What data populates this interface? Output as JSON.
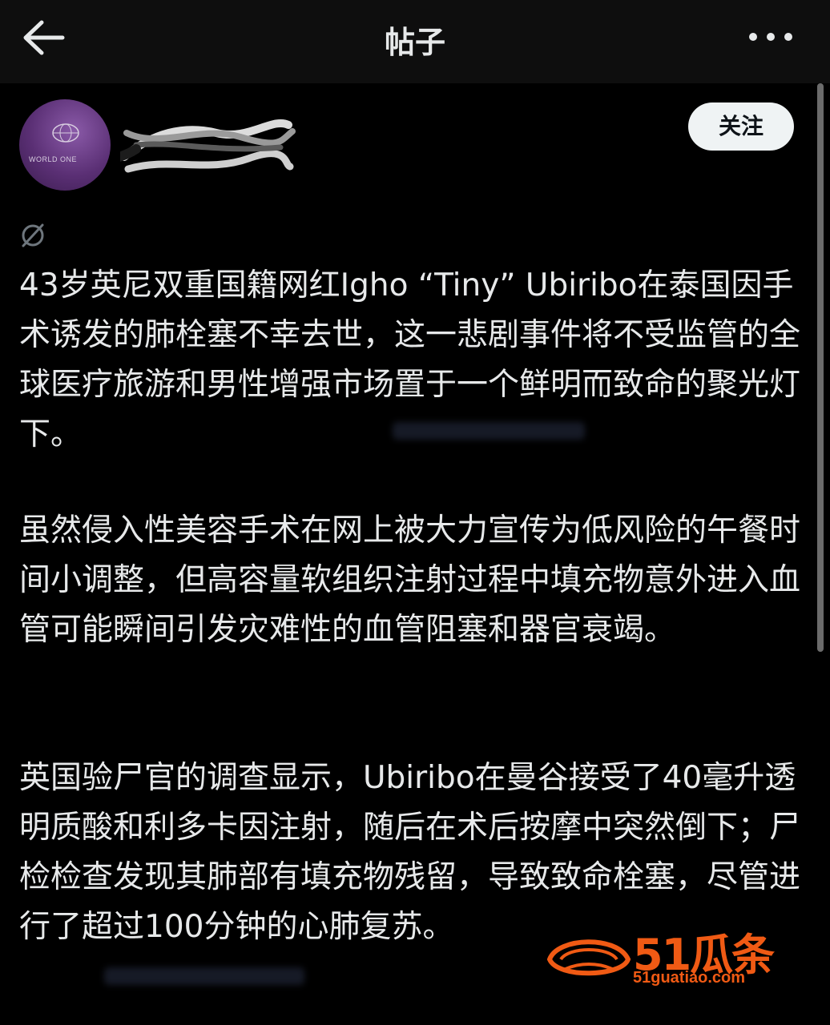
{
  "header": {
    "title": "帖子",
    "back_icon": "arrow-left-icon",
    "more_icon": "more-horizontal-icon"
  },
  "author": {
    "avatar_text": "WORLD ONE",
    "follow_label": "关注"
  },
  "post": {
    "translate_icon": "translate-icon",
    "paragraphs": [
      "43岁英尼双重国籍网红Igho “Tiny” Ubiribo在泰国因手术诱发的肺栓塞不幸去世，这一悲剧事件将不受监管的全球医疗旅游和男性增强市场置于一个鲜明而致命的聚光灯下。",
      "虽然侵入性美容手术在网上被大力宣传为低风险的午餐时间小调整，但高容量软组织注射过程中填充物意外进入血管可能瞬间引发灾难性的血管阻塞和器官衰竭。",
      "英国验尸官的调查显示，Ubiribo在曼谷接受了40毫升透明质酸和利多卡因注射，随后在术后按摩中突然倒下；尸检检查发现其肺部有填充物残留，导致致命栓塞，尽管进行了超过100分钟的心肺复苏。"
    ]
  },
  "watermark": {
    "logo": "51瓜条",
    "url": "51guatiao.com"
  },
  "colors": {
    "background": "#000000",
    "text": "#e7e9ea",
    "follow_bg": "#eff3f4",
    "watermark": "#f05a14"
  }
}
